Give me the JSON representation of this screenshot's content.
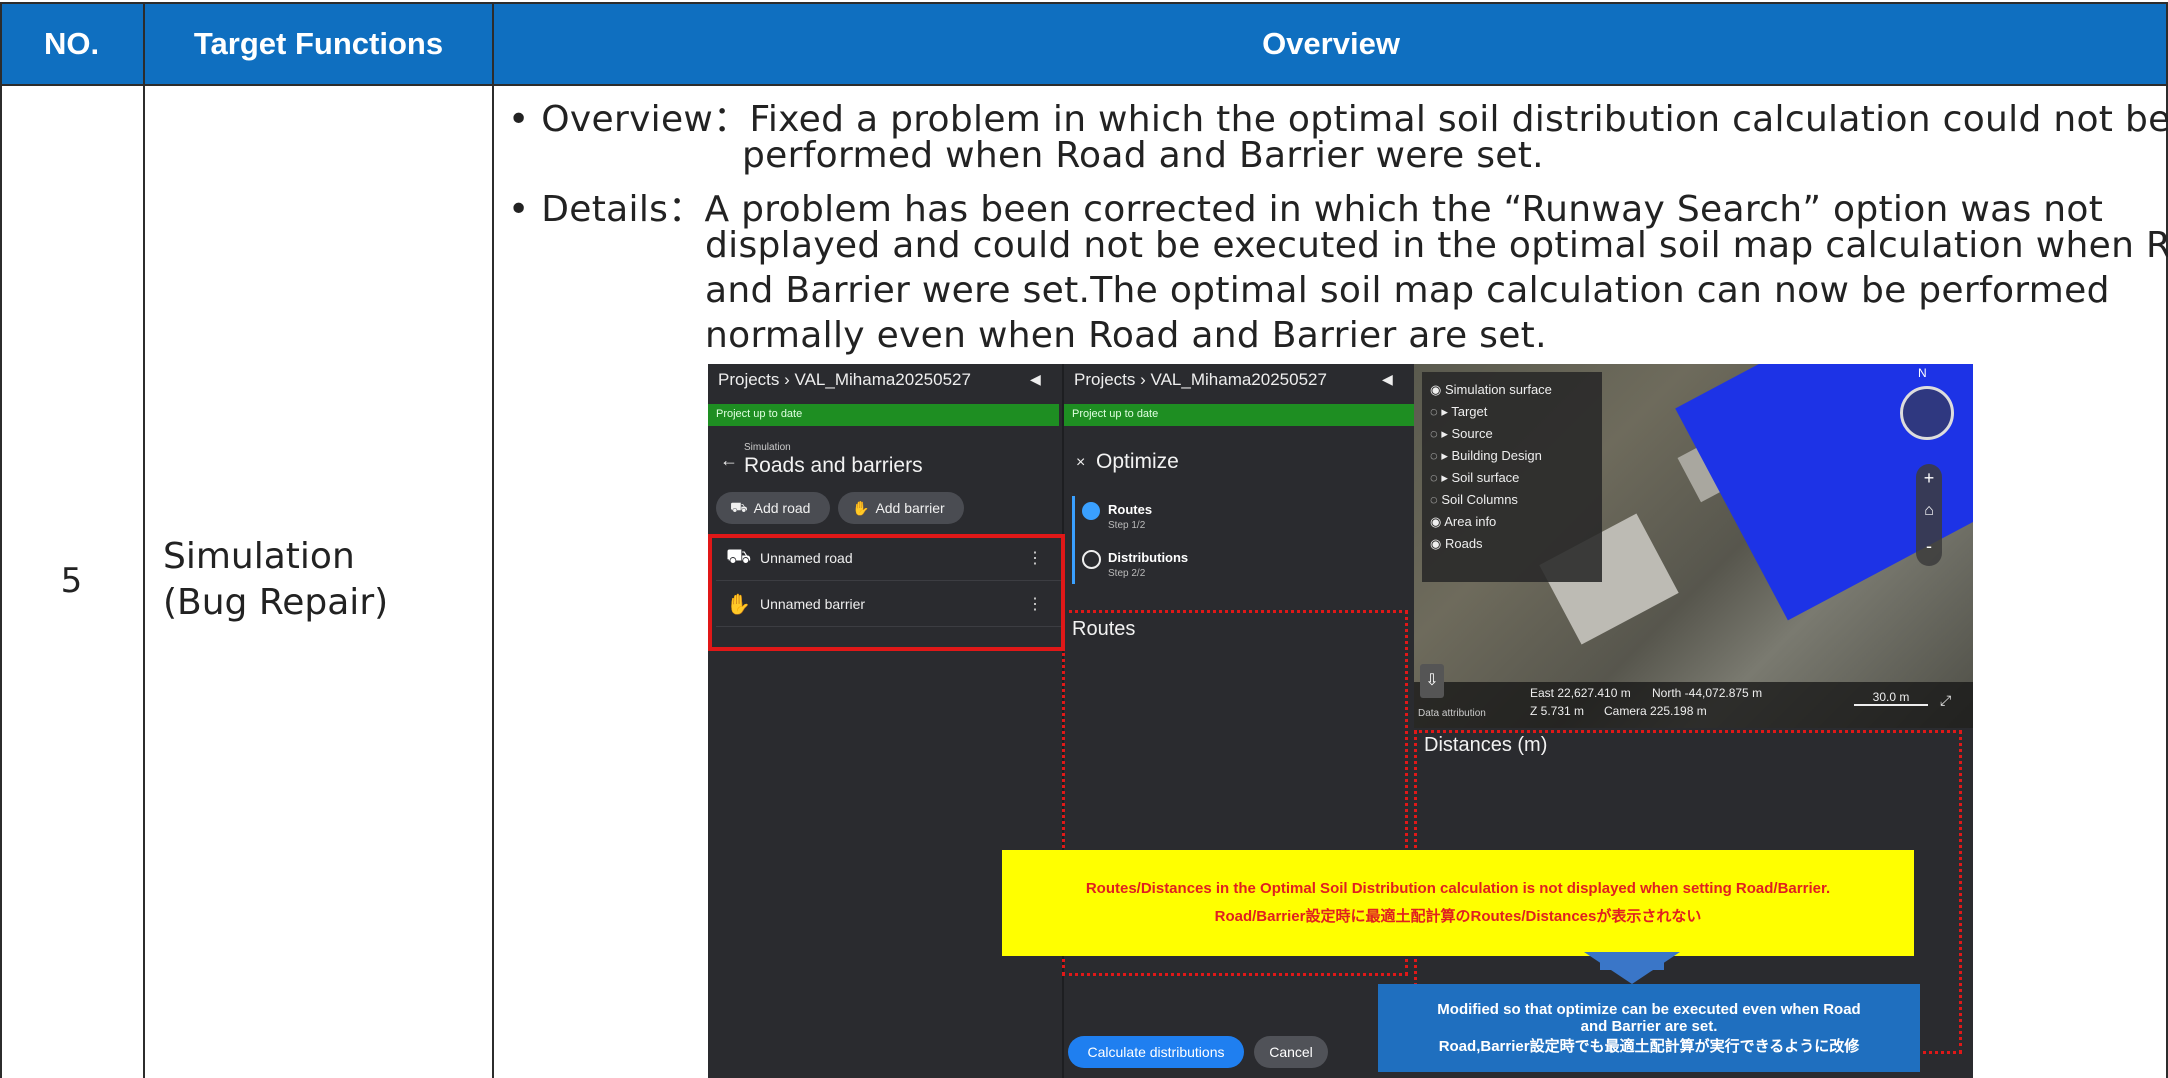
{
  "table": {
    "headers": {
      "no": "NO.",
      "target": "Target Functions",
      "overview": "Overview"
    },
    "row": {
      "no": "5",
      "target": "Simulation\n(Bug Repair)",
      "overview_line1": "• Overview：Fixed a problem in which the optimal soil distribution calculation could not be",
      "overview_line2": "performed when Road and Barrier were set.",
      "details_line1": "• Details：A problem has been corrected in which the “Runway Search” option was not",
      "details_line2": "displayed and could not be executed in the optimal soil map calculation when Road",
      "details_line3": "and Barrier were set.The optimal soil map calculation can now be performed",
      "details_line4": "normally even when Road and Barrier are set."
    }
  },
  "screenshot": {
    "left_panel": {
      "breadcrumb": "Projects › VAL_Mihama20250527",
      "status": "Project up to date",
      "section_small": "Simulation",
      "section_title": "Roads and barriers",
      "add_road": "Add road",
      "add_barrier": "Add barrier",
      "items": [
        "Unnamed road",
        "Unnamed barrier"
      ]
    },
    "middle_panel": {
      "breadcrumb": "Projects › VAL_Mihama20250527",
      "status": "Project up to date",
      "title": "Optimize",
      "steps": [
        {
          "label": "Routes",
          "sub": "Step 1/2"
        },
        {
          "label": "Distributions",
          "sub": "Step 2/2"
        }
      ],
      "routes_heading": "Routes",
      "calc_button": "Calculate distributions",
      "cancel_button": "Cancel"
    },
    "map": {
      "layers": [
        "Simulation surface",
        "Target",
        "Source",
        "Building Design",
        "Soil surface",
        "Soil Columns",
        "Area info",
        "Roads"
      ],
      "north": "N",
      "east": "East 22,627.410 m",
      "north_coord": "North -44,072.875 m",
      "z": "Z 5.731 m",
      "camera": "Camera 225.198 m",
      "scale": "30.0 m",
      "attribution": "Data attribution",
      "distances_heading": "Distances (m)"
    },
    "callouts": {
      "yellow_en": "Routes/Distances in the Optimal Soil Distribution calculation is not displayed when setting Road/Barrier.",
      "yellow_jp": "Road/Barrier設定時に最適土配計算のRoutes/Distancesが表示されない",
      "blue_en_1": "Modified so that optimize can be executed even when Road",
      "blue_en_2": "and Barrier are set.",
      "blue_jp": "Road,Barrier設定時でも最適土配計算が実行できるように改修"
    }
  }
}
